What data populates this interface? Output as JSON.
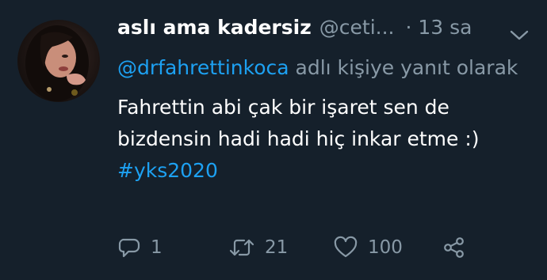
{
  "tweet": {
    "display_name": "aslı ama kadersiz",
    "handle": "@ceti...",
    "time": "· 13 sa",
    "reply_mention": "@drfahrettinkoca",
    "reply_suffix": " adlı kişiye yanıt olarak",
    "text_line1": "Fahrettin abi çak bir işaret sen de",
    "text_line2": "bizdensin hadi hadi hiç inkar etme :)",
    "hashtag": "#yks2020"
  },
  "actions": {
    "reply_icon": "reply-icon",
    "reply_count": "1",
    "retweet_icon": "retweet-icon",
    "retweet_count": "21",
    "like_icon": "heart-icon",
    "like_count": "100",
    "share_icon": "share-icon"
  },
  "colors": {
    "background": "#15202b",
    "accent": "#1da1f2",
    "muted": "#8899a6",
    "text": "#ffffff"
  }
}
